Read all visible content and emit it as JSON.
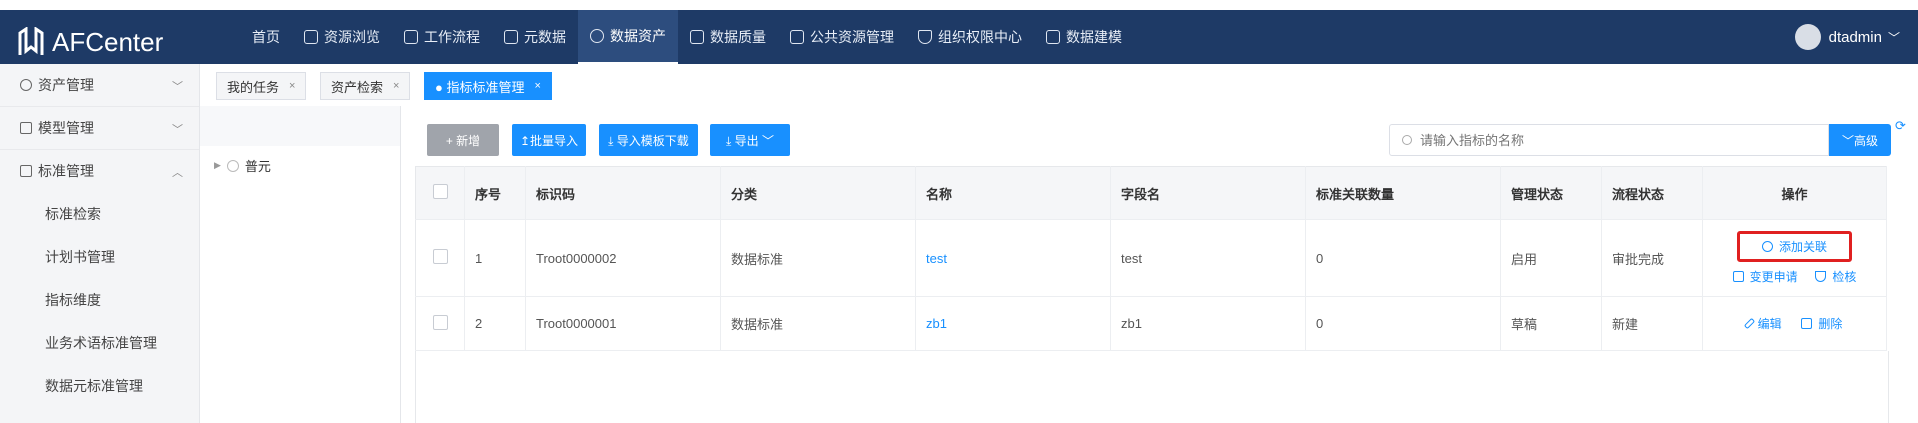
{
  "app": {
    "title": "AFCenter"
  },
  "nav": [
    {
      "label": "首页",
      "icon": "home-icon"
    },
    {
      "label": "资源浏览",
      "icon": "grid-icon"
    },
    {
      "label": "工作流程",
      "icon": "workflow-icon"
    },
    {
      "label": "元数据",
      "icon": "layers-icon"
    },
    {
      "label": "数据资产",
      "icon": "asset-icon",
      "active": true
    },
    {
      "label": "数据质量",
      "icon": "chart-icon"
    },
    {
      "label": "公共资源管理",
      "icon": "doc-icon"
    },
    {
      "label": "组织权限中心",
      "icon": "shield-icon"
    },
    {
      "label": "数据建模",
      "icon": "stack-icon"
    }
  ],
  "user": {
    "name": "dtadmin"
  },
  "sidebar": {
    "groups": [
      {
        "label": "资产管理",
        "arrow": "﹀"
      },
      {
        "label": "模型管理",
        "arrow": "﹀"
      },
      {
        "label": "标准管理",
        "arrow": "︿"
      }
    ],
    "items": [
      {
        "label": "标准检索"
      },
      {
        "label": "计划书管理"
      },
      {
        "label": "指标维度"
      },
      {
        "label": "业务术语标准管理"
      },
      {
        "label": "数据元标准管理"
      }
    ]
  },
  "tabs": [
    {
      "label": "我的任务",
      "close": "×"
    },
    {
      "label": "资产检索",
      "close": "×"
    },
    {
      "label": "● 指标标准管理",
      "close": "×",
      "active": true
    }
  ],
  "tree": {
    "node": "普元"
  },
  "toolbar": {
    "new": "+ 新增",
    "batch_import": "↥批量导入",
    "template_download": "⤓ 导入模板下载",
    "export": "⤓ 导出  ﹀",
    "search_placeholder": "请输入指标的名称",
    "advanced": "﹀高级"
  },
  "table": {
    "headers": [
      "序号",
      "标识码",
      "分类",
      "名称",
      "字段名",
      "标准关联数量",
      "管理状态",
      "流程状态",
      "操作"
    ],
    "rows": [
      {
        "index": "1",
        "code": "Troot0000002",
        "category": "数据标准",
        "name": "test",
        "field": "test",
        "count": "0",
        "manage_status": "启用",
        "flow_status": "审批完成",
        "ops": [
          "添加关联",
          "变更申请",
          "检核"
        ]
      },
      {
        "index": "2",
        "code": "Troot0000001",
        "category": "数据标准",
        "name": "zb1",
        "field": "zb1",
        "count": "0",
        "manage_status": "草稿",
        "flow_status": "新建",
        "ops": [
          "编辑",
          "删除"
        ]
      }
    ]
  },
  "colors": {
    "topbar": "#1e3a66",
    "primary": "#1890ff",
    "highlight": "#e02020"
  }
}
